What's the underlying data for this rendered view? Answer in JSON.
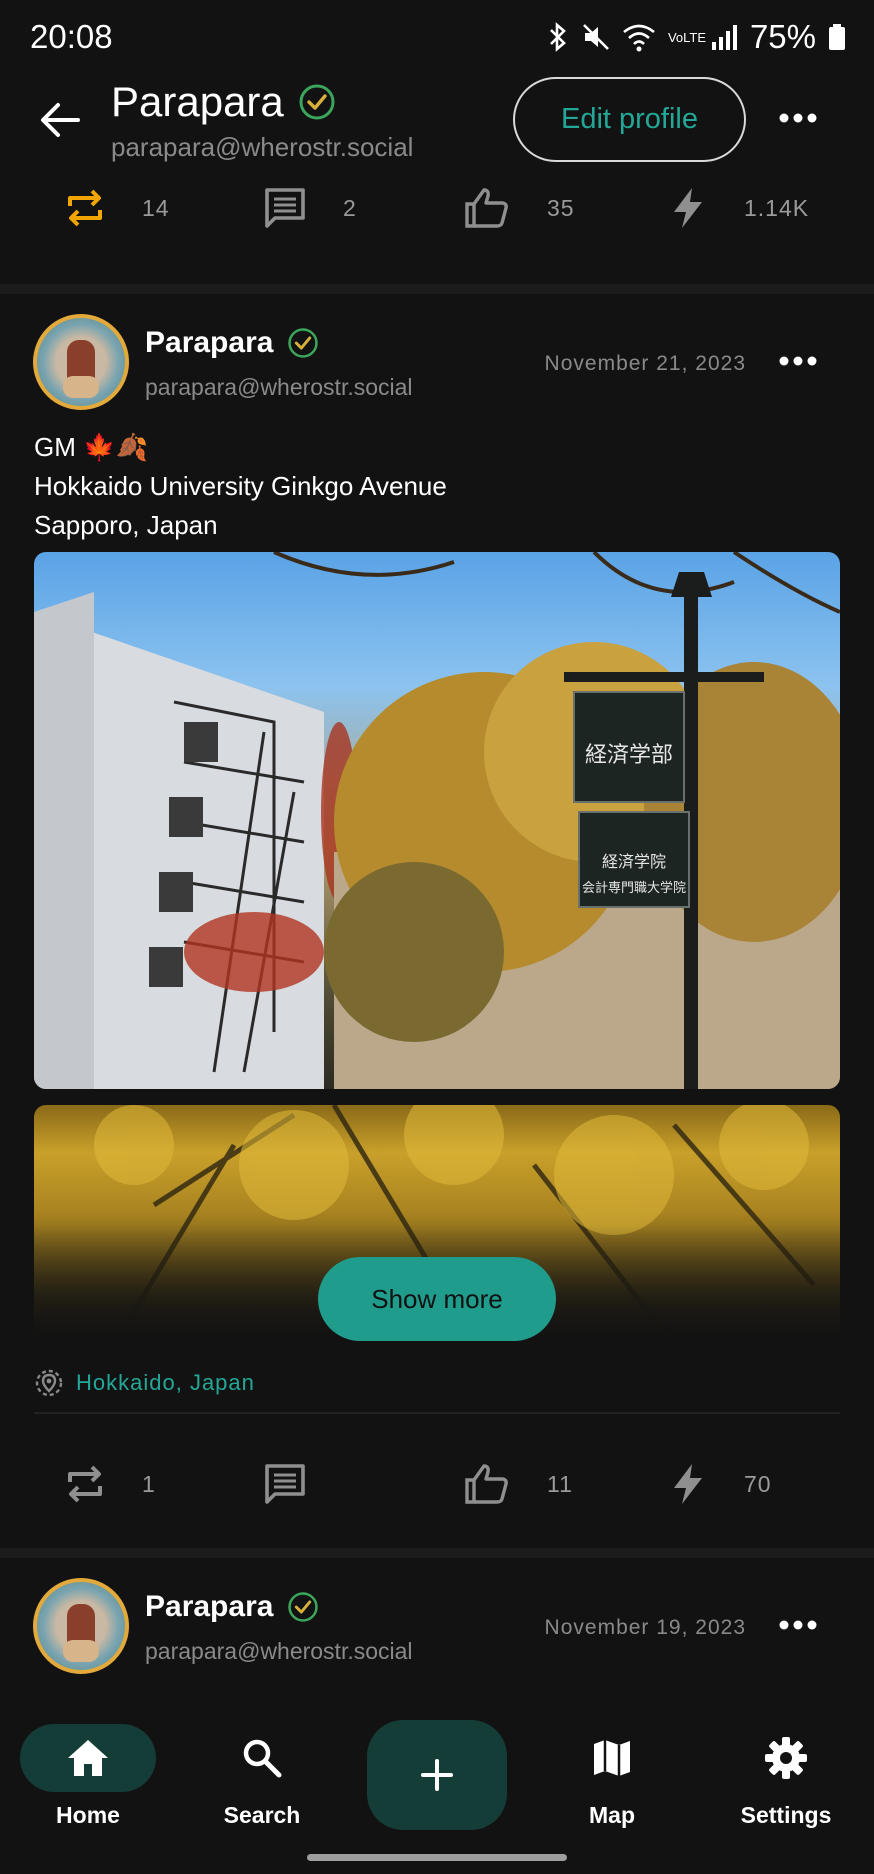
{
  "status_bar": {
    "time": "20:08",
    "battery": "75%",
    "network": "VoLTE"
  },
  "app_bar": {
    "name": "Parapara",
    "handle": "parapara@wherostr.social",
    "edit_label": "Edit profile"
  },
  "prev_post_actions": {
    "reposts": "14",
    "comments": "2",
    "likes": "35",
    "zaps": "1.14K"
  },
  "post1": {
    "name": "Parapara",
    "handle": "parapara@wherostr.social",
    "date": "November 21, 2023",
    "text_line1": "GM 🍁🍂",
    "text_line2": "Hokkaido University Ginkgo Avenue",
    "text_line3": "Sapporo, Japan",
    "sign_line1": "経済学部",
    "sign_line2": "経済学院",
    "sign_line3": "会計専門職大学院",
    "show_more": "Show more",
    "location": "Hokkaido, Japan",
    "actions": {
      "reposts": "1",
      "comments": "",
      "likes": "11",
      "zaps": "70"
    }
  },
  "post2": {
    "name": "Parapara",
    "handle": "parapara@wherostr.social",
    "date": "November 19, 2023"
  },
  "bottom_nav": {
    "home": "Home",
    "search": "Search",
    "map": "Map",
    "settings": "Settings"
  },
  "colors": {
    "accent": "#23a898",
    "repost_active": "#f0a500",
    "nav_active_bg": "#143d38"
  }
}
